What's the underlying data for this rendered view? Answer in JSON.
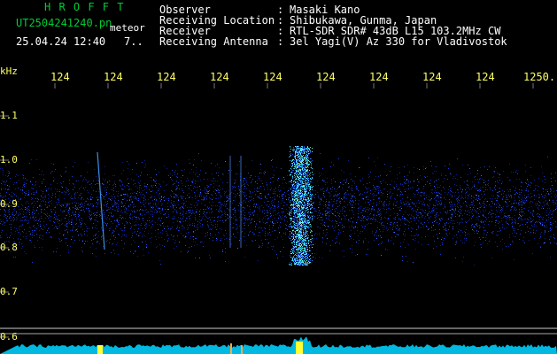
{
  "header": {
    "app_title": "H R O F F T",
    "file_name": "UT2504241240.pn",
    "file_suffix": "meteor",
    "datetime": "25.04.24 12:40",
    "count": "7..",
    "observer_label": "Observer",
    "observer_value": "Masaki Kano",
    "location_label": "Receiving Location",
    "location_value": "Shibukawa, Gunma, Japan",
    "receiver_label": "Receiver",
    "receiver_value": "RTL-SDR SDR# 43dB L15 103.2MHz CW",
    "antenna_label": "Receiving Antenna",
    "antenna_value": "3el Yagi(V) Az 330 for Vladivostok",
    "colon": ":"
  },
  "axis": {
    "unit": "kHz",
    "x_labels": [
      "124",
      "124",
      "124",
      "124",
      "124",
      "124",
      "124",
      "124",
      "124",
      "1250."
    ],
    "y_labels": [
      "1.1",
      "1.0",
      "0.9",
      "0.8",
      "0.7",
      "0.6"
    ]
  },
  "colors": {
    "background": "#000000",
    "header_green": "#00cc33",
    "label_yellow": "#ffff66",
    "noise_blue": "#1a3fd0",
    "echo_cyan": "#40e0ff",
    "baseline_cyan": "#00c0e0"
  }
}
